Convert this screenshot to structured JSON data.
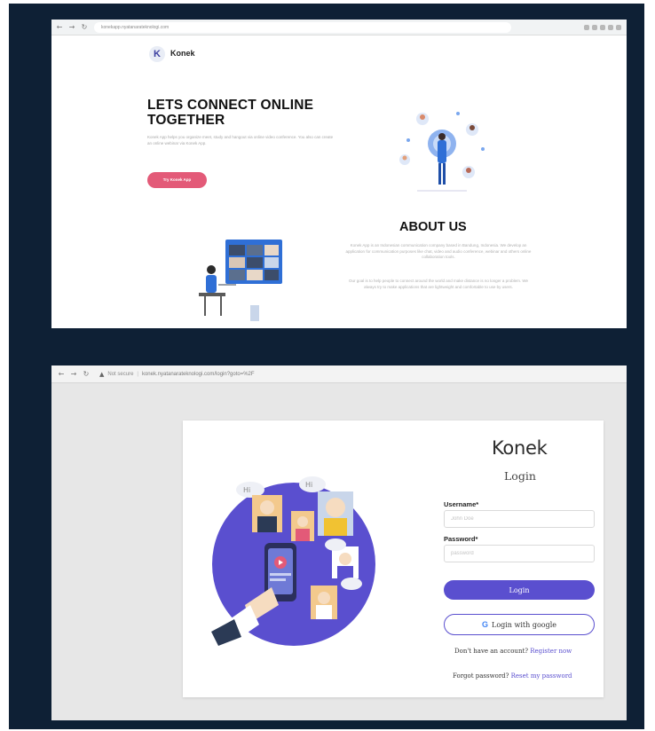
{
  "landing": {
    "url": "konekapp.nyatanarateknologi.com",
    "brand": "Konek",
    "logo_letter": "K",
    "hero_title": "LETS CONNECT ONLINE TOGETHER",
    "hero_desc": "Konek App helps you organize meet, study and hangout via online video conference. You also can create an online webinar via Konek App.",
    "cta_label": "Try Konek App",
    "about_title": "ABOUT US",
    "about_p1": "Konek App is an Indonesian communication company based in Bandung, Indonesia. We develop an application for communication purposes like chat, video and audio conference, webinar and others online collaboration tools.",
    "about_p2": "Our goal is to help people to connect around the world and make distance is no longer a problem. We always try to make applications that are lightweight and comfortable to use by users.",
    "accent": "#e35a78"
  },
  "login": {
    "security": "Not secure",
    "url": "konek.nyatanarateknologi.com/login?goto=%2F",
    "brand": "Konek",
    "title": "Login",
    "username_label": "Username",
    "username_placeholder": "John Doe",
    "password_label": "Password",
    "password_placeholder": "password",
    "login_button": "Login",
    "google_button": "Login with google",
    "no_account_text": "Don't have an account?",
    "register_link": "Register now",
    "forgot_text": "Forgot password?",
    "reset_link": "Reset my password",
    "accent": "#5a4fcf"
  }
}
